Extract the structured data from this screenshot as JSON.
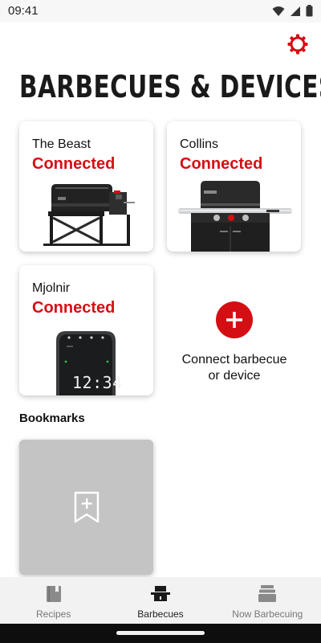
{
  "status_bar": {
    "time": "09:41",
    "icons": [
      "wifi-icon",
      "signal-icon",
      "battery-icon"
    ]
  },
  "header": {
    "title": "BARBECUES & DEVICES",
    "settings_icon": "gear-icon"
  },
  "devices": [
    {
      "name": "The Beast",
      "status": "Connected",
      "image": "pellet-grill"
    },
    {
      "name": "Collins",
      "status": "Connected",
      "image": "gas-grill"
    },
    {
      "name": "Mjolnir",
      "status": "Connected",
      "image": "thermometer-hub",
      "display": "12:34"
    }
  ],
  "connect": {
    "label_line1": "Connect barbecue",
    "label_line2": "or device",
    "icon": "plus-icon"
  },
  "bookmarks": {
    "title": "Bookmarks",
    "add_icon": "bookmark-add-icon"
  },
  "bottom_nav": {
    "items": [
      {
        "label": "Recipes",
        "icon": "book-icon"
      },
      {
        "label": "Barbecues",
        "icon": "grill-icon",
        "active": true
      },
      {
        "label": "Now Barbecuing",
        "icon": "layers-icon"
      }
    ]
  },
  "colors": {
    "accent": "#d40f14",
    "card_bg": "#ffffff",
    "bookmark_bg": "#c4c4c4",
    "nav_bg": "#f2f2f2"
  }
}
